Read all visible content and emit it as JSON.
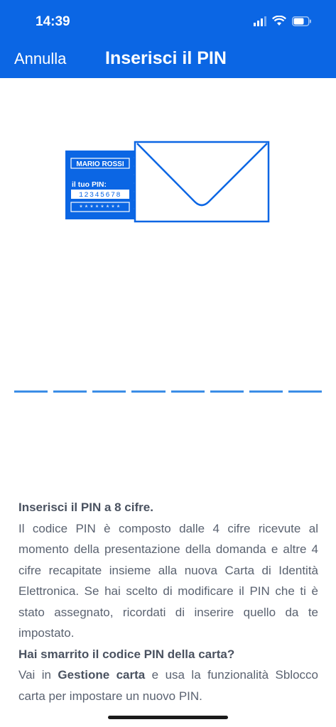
{
  "status_bar": {
    "time": "14:39",
    "icons": [
      "signal-icon",
      "wifi-icon",
      "battery-icon"
    ]
  },
  "nav": {
    "cancel_label": "Annulla",
    "title": "Inserisci il PIN"
  },
  "illustration": {
    "name_label": "MARIO ROSSI",
    "pin_caption": "il tuo PIN:",
    "pin_digits": "12345678",
    "masked_pin": "********"
  },
  "pin_entry": {
    "length": 8
  },
  "instructions": {
    "heading": "Inserisci il PIN a 8 cifre.",
    "body": "Il codice PIN è composto dalle 4 cifre ricevute al momento della presentazione della domanda e altre 4 cifre recapitate insieme alla nuova Carta di Identità Elettronica. Se hai scelto di modificare il PIN che ti è stato assegnato, ricordati di inserire quello da te impostato.",
    "lost_heading": "Hai smarrito il codice PIN della carta?",
    "lost_prefix": "Vai in ",
    "lost_link": "Gestione carta",
    "lost_suffix": " e usa la funzionalità Sblocco carta per impostare un nuovo PIN."
  },
  "colors": {
    "brand_blue": "#0b66e4",
    "input_line": "#3b8de6",
    "text": "#5a6270"
  }
}
